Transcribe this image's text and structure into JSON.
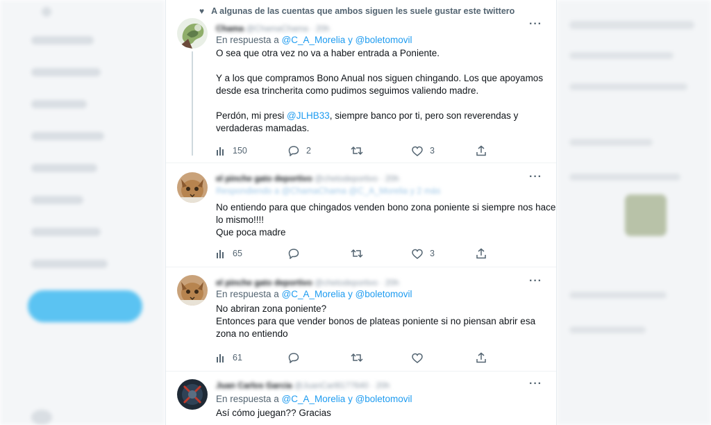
{
  "social_context": "A algunas de las cuentas que ambos siguen les suele gustar este twittero",
  "tweets": [
    {
      "display_name": "Chama",
      "handle": "@ChamaChama · 20h",
      "reply_prefix": "En respuesta a",
      "reply_to": "@C_A_Morelia y @boletomovil",
      "line1": "O sea que otra vez no va a haber entrada a Poniente.",
      "line2": "Y a los que compramos Bono Anual nos siguen chingando. Los que apoyamos desde esa trincherita como pudimos seguimos valiendo madre.",
      "line3_pre": "Perdón, mi presi ",
      "line3_mention": "@JLHB33",
      "line3_post": ", siempre banco por ti, pero son reverendas y verdaderas mamadas.",
      "views": "150",
      "replies": "2",
      "retweets": "",
      "likes": "3"
    },
    {
      "display_name": "el pinche gato deportivo",
      "handle": "@chetodeportivo · 20h",
      "reply_line": "Respondiendo a @ChamaChama @C_A_Morelia y 2 más",
      "line1": "No entiendo para que chingados venden bono zona poniente si siempre nos hacen lo mismo!!!!",
      "line2": "Que poca madre",
      "views": "65",
      "replies": "",
      "retweets": "",
      "likes": "3"
    },
    {
      "display_name": "el pinche gato deportivo",
      "handle": "@chetodeportivo · 20h",
      "reply_prefix": "En respuesta a",
      "reply_to": "@C_A_Morelia y @boletomovil",
      "line1": "No abriran zona poniente?",
      "line2": "Entonces para que vender bonos de plateas poniente si no piensan abrir esa zona no entiendo",
      "views": "61",
      "replies": "",
      "retweets": "",
      "likes": ""
    },
    {
      "display_name": "Juan Carlos Garcia",
      "handle": "@JuanCarl8177640 · 20h",
      "reply_prefix": "En respuesta a",
      "reply_to": "@C_A_Morelia y @boletomovil",
      "line1": "Así cómo juegan?? Gracias"
    }
  ],
  "colors": {
    "accent": "#1d9bf0",
    "muted": "#536471",
    "text": "#0f1419"
  },
  "icons": [
    "heart-icon",
    "more-icon",
    "views-icon",
    "reply-icon",
    "retweet-icon",
    "like-icon",
    "share-icon"
  ]
}
